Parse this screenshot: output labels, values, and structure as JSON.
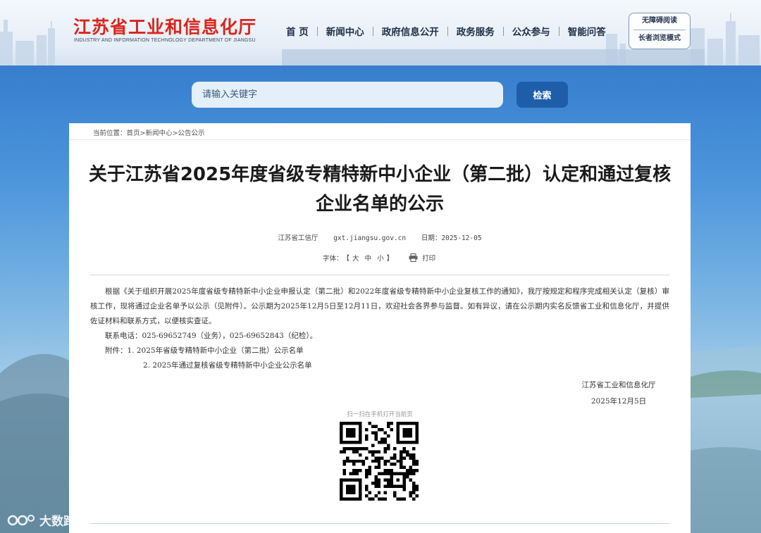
{
  "header": {
    "logo_cn": "江苏省工业和信息化厅",
    "logo_en": "INDUSTRY AND INFORMATION TECHNOLOGY DEPARTMENT OF JIANGSU",
    "nav": [
      "首 页",
      "新闻中心",
      "政府信息公开",
      "政务服务",
      "公众参与",
      "智能问答"
    ],
    "access": [
      "无障碍阅读",
      "长者浏览模式"
    ]
  },
  "search": {
    "placeholder": "请输入关键字",
    "button": "检索"
  },
  "breadcrumb": {
    "prefix": "当前位置：",
    "items": [
      "首页",
      "新闻中心",
      "公告公示"
    ],
    "sep": ">"
  },
  "article": {
    "title": "关于江苏省2025年度省级专精特新中小企业（第二批）认定和通过复核企业名单的公示",
    "source": "江苏省工信厅",
    "site": "gxt.jiangsu.gov.cn",
    "date_label": "日期：",
    "date": "2025-12-05",
    "font_label": "字体：",
    "font_sizes": [
      "大",
      "中",
      "小"
    ],
    "print": "打印",
    "paragraph": "根据《关于组织开展2025年度省级专精特新中小企业申报认定（第二批）和2022年度省级专精特新中小企业复核工作的通知》，我厅按规定和程序完成相关认定（复核）审核工作，现将通过企业名单予以公示（见附件）。公示期为2025年12月5日至12月11日，欢迎社会各界参与监督。如有异议，请在公示期内实名反馈省工业和信息化厅，并提供佐证材料和联系方式，以便核实查证。",
    "contact": "联系电话：025-69652749（业务），025-69652843（纪检）。",
    "attach_label": "附件：",
    "attachments": [
      "1. 2025年省级专精特新中小企业（第二批）公示名单",
      "2. 2025年通过复核省级专精特新中小企业公示名单"
    ],
    "signer": "江苏省工业和信息化厅",
    "sign_date": "2025年12月5日"
  },
  "qr": {
    "caption": "扫一扫在手机打开当前页"
  },
  "watermark": "大数跨境"
}
